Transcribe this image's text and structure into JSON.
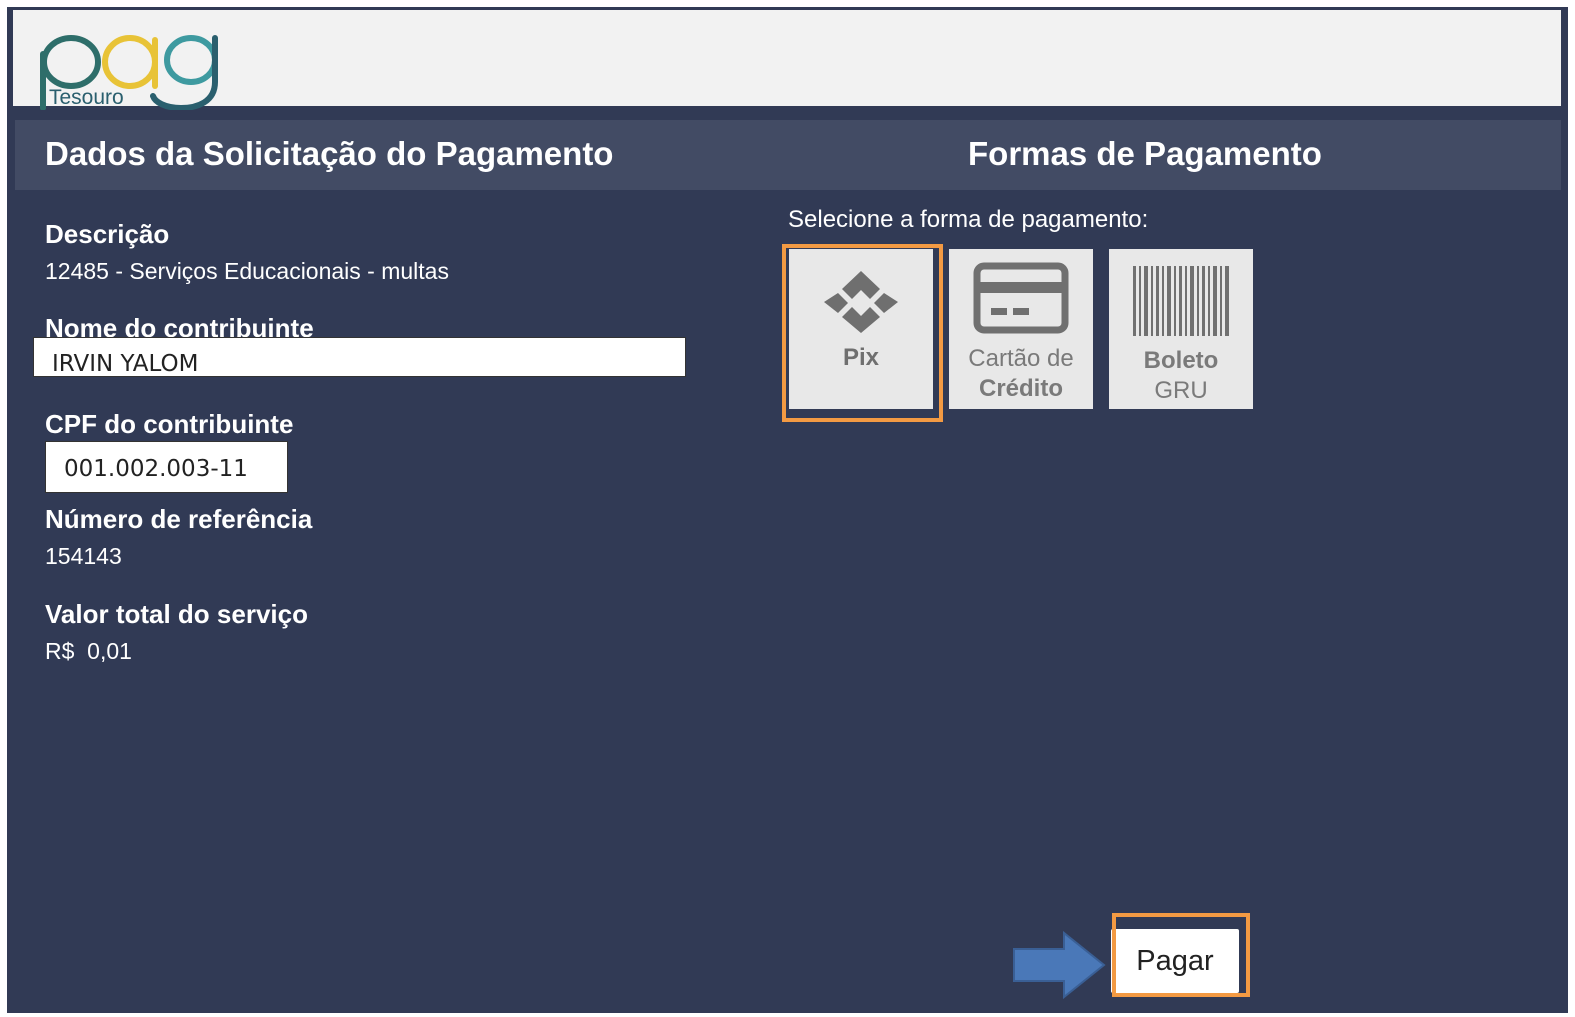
{
  "logo": {
    "wordmark": "pag",
    "caption": "Tesouro"
  },
  "header": {
    "left_title": "Dados da Solicitação do Pagamento",
    "right_title": "Formas de Pagamento"
  },
  "details": {
    "descricao_label": "Descrição",
    "descricao_value": "12485 - Serviços Educacionais - multas",
    "nome_label": "Nome do contribuinte",
    "nome_value": "IRVIN YALOM",
    "cpf_label": "CPF do contribuinte",
    "cpf_value": "001.002.003-11",
    "referencia_label": "Número de referência",
    "referencia_value": "154143",
    "valor_label": "Valor total do serviço",
    "valor_value": "R$  0,01"
  },
  "payment": {
    "select_label": "Selecione a forma de pagamento:",
    "pix_label": "Pix",
    "card_line1": "Cartão de",
    "card_line2": "Crédito",
    "boleto_line1": "Boleto",
    "boleto_line2": "GRU",
    "selected": "Pix"
  },
  "actions": {
    "pay_label": "Pagar"
  },
  "colors": {
    "background": "#313a55",
    "header_bar": "#424b64",
    "highlight": "#f39a43",
    "arrow": "#4a78b8",
    "tile": "#e8e8e8"
  },
  "icons": [
    "pix-icon",
    "credit-card-icon",
    "barcode-icon",
    "arrow-right-icon"
  ]
}
